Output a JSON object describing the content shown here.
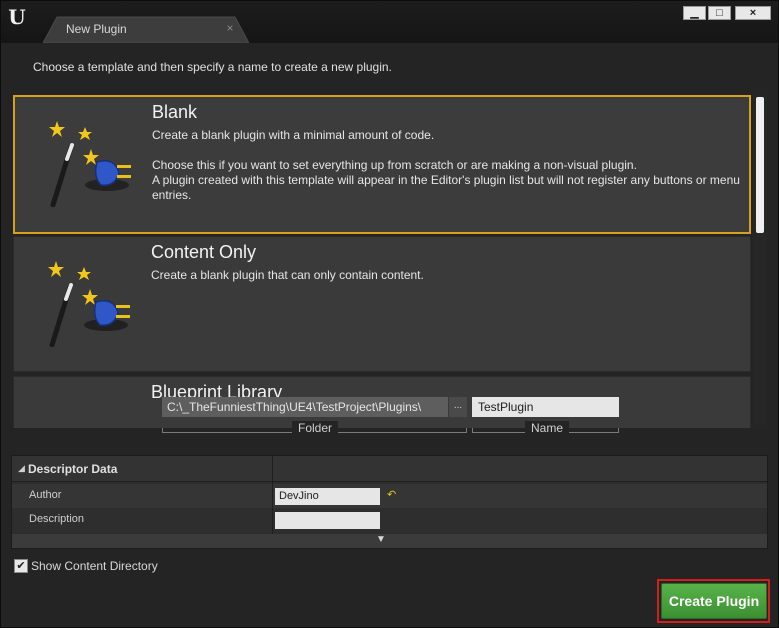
{
  "window": {
    "logo": "U",
    "tab_title": "New Plugin",
    "tab_close": "×",
    "min_glyph": "▁",
    "max_glyph": "□",
    "close_glyph": "×"
  },
  "intro_text": "Choose a template and then specify a name to create a new plugin.",
  "templates": [
    {
      "title": "Blank",
      "description": "Create a blank plugin with a minimal amount of code.\n\nChoose this if you want to set everything up from scratch or are making a non-visual plugin.\nA plugin created with this template will appear in the Editor's plugin list but will not register any buttons or menu entries.",
      "selected": true,
      "icon": "magic-wand-plug-icon"
    },
    {
      "title": "Content Only",
      "description": "Create a blank plugin that can only contain content.",
      "selected": false,
      "icon": "magic-wand-plug-icon"
    },
    {
      "title": "Blueprint Library",
      "description": "",
      "selected": false,
      "icon": "magic-wand-plug-icon"
    }
  ],
  "path": {
    "folder_value": "C:\\_TheFunniestThing\\UE4\\TestProject\\Plugins\\",
    "browse_label": "...",
    "name_value": "TestPlugin",
    "folder_caption": "Folder",
    "name_caption": "Name"
  },
  "descriptor": {
    "title": "Descriptor Data",
    "collapse_glyph": "◢",
    "expand_glyph": "▼",
    "reset_glyph": "↶",
    "fields": {
      "author_label": "Author",
      "author_value": "DevJino",
      "description_label": "Description",
      "description_value": ""
    }
  },
  "show_content": {
    "label": "Show Content Directory",
    "checked": true,
    "check_glyph": "✔"
  },
  "create_button": "Create Plugin",
  "colors": {
    "selection_border": "#d7a21a",
    "create_button": "#4ca53f",
    "highlight_frame": "#d41d1d"
  }
}
